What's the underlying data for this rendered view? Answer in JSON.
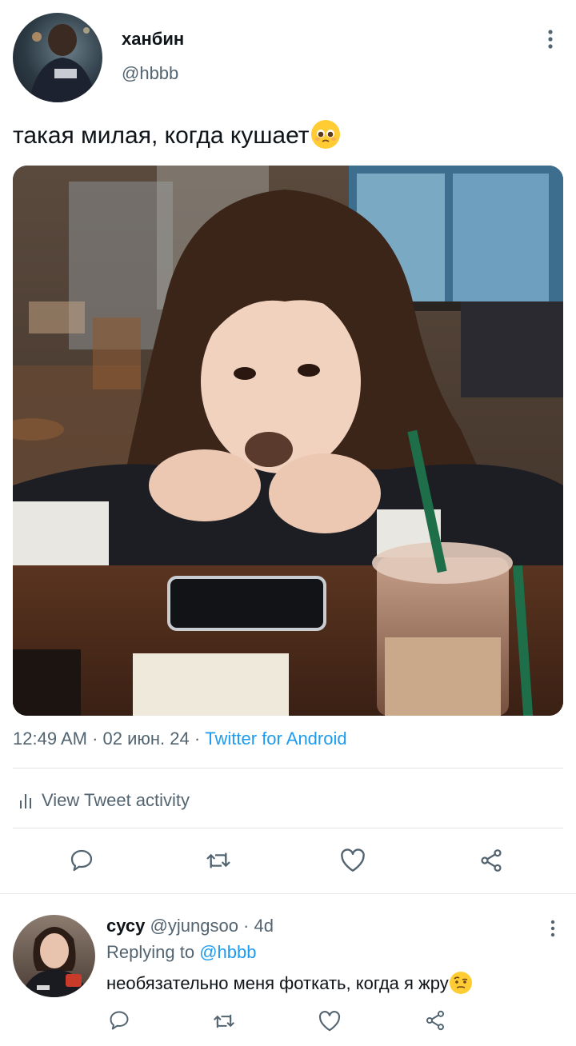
{
  "tweet": {
    "author_name": "ханбин",
    "author_handle": "@hbbb",
    "text": "такая милая, когда кушает",
    "time": "12:49 AM",
    "date": "02 июн. 24",
    "source": "Twitter for Android",
    "activity_label": "View Tweet activity",
    "image_icon": "photo-girl-eating-in-cafe",
    "avatar_icon": "person-back-photo"
  },
  "reply": {
    "author_name": "сусу",
    "author_handle": "@yjungsoo",
    "age": "4d",
    "replying_label": "Replying to",
    "replying_handle": "@hbbb",
    "text": "необязательно меня фоткать, когда я жру",
    "avatar_icon": "girl-holding-cup-photo"
  },
  "icons": [
    "more-icon",
    "reply-icon",
    "retweet-icon",
    "like-icon",
    "share-icon",
    "activity-icon"
  ],
  "colors": {
    "accent": "#1d9bf0",
    "muted": "#536471",
    "text": "#0f1419"
  }
}
